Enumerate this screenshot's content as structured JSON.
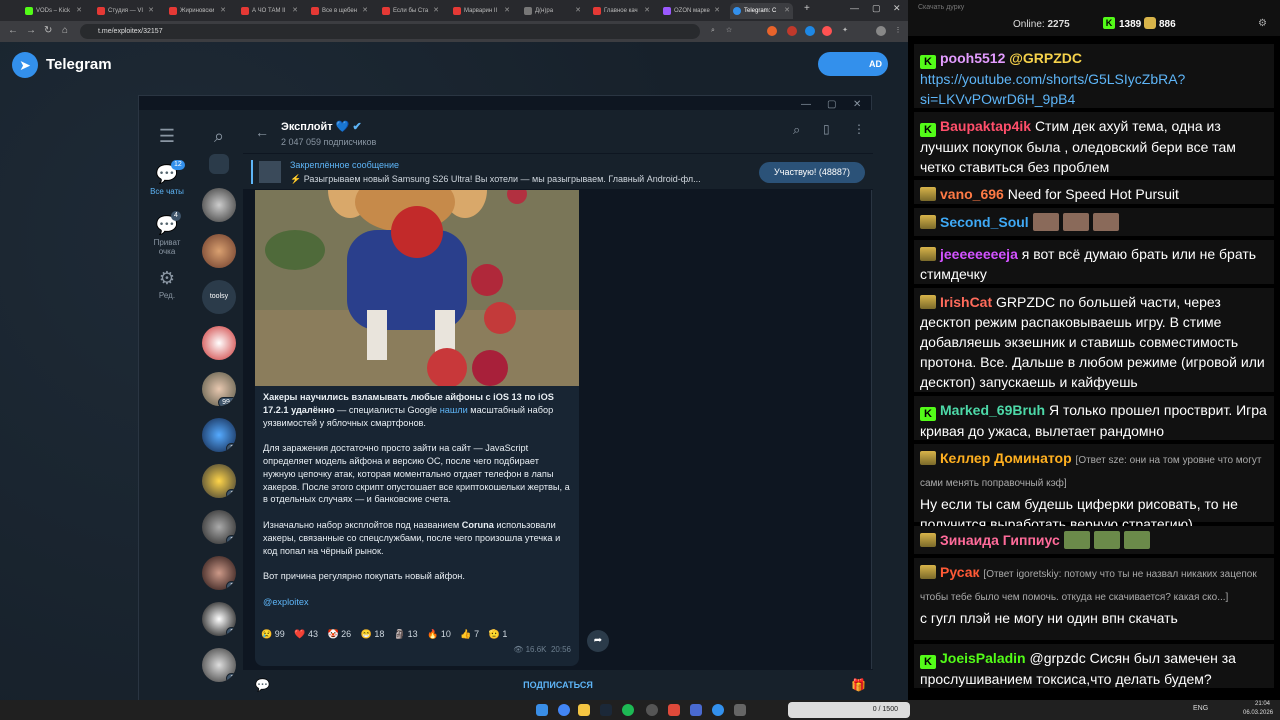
{
  "browser": {
    "tabs": [
      "VODs – Kick",
      "Студия — VI",
      "Жириновски",
      "А ЧО ТАМ II",
      "Все в щебен",
      "Если бы Ста",
      "Марварин II",
      "Д(н)ра",
      "Главное кач",
      "OZON марке",
      "Telegram: C"
    ],
    "url": "t.me/exploitex/32157"
  },
  "tgpage": {
    "title": "Telegram",
    "download": "AD"
  },
  "tgapp": {
    "nav": [
      {
        "label": "Все чаты",
        "badge": "12"
      },
      {
        "label": "Приват очка",
        "badge": "4"
      },
      {
        "label": "Ред."
      }
    ],
    "chat_badges": [
      "99+",
      "2",
      "1",
      "2",
      "2",
      "2",
      "1"
    ],
    "channel_name": "Эксплойт",
    "subscribers": "2 047 059 подписчиков",
    "pinned_title": "Закреплённое сообщение",
    "pinned_text": "⚡ Разыгрываем новый Samsung S26 Ultra! Вы хотели — мы разыгрываем. Главный Android-фл...",
    "join_button": "Участвую! (48887)",
    "msg_title": "Хакеры научились взламывать любые айфоны с iOS 13 по iOS 17.2.1 удалённо",
    "msg_p1_a": " — специалисты Google ",
    "msg_p1_link": "нашли",
    "msg_p1_b": " масштабный набор уязвимостей у яблочных смартфонов.",
    "msg_p2": "Для заражения достаточно просто зайти на сайт — JavaScript определяет модель айфона и версию ОС, после чего подбирает нужную цепочку атак, которая моментально отдает телефон в лапы хакеров. После этого скрипт опустошает все криптокошельки жертвы, а в отдельных случаях — и банковские счета.",
    "msg_p3_a": "Изначально набор эксплойтов под названием ",
    "msg_p3_bold": "Coruna",
    "msg_p3_b": " использовали хакеры, связанные со спецслужбами, после чего произошла утечка и код попал на чёрный рынок.",
    "msg_p4": "Вот причина регулярно покупать новый айфон.",
    "msg_tag": "@exploitex",
    "reactions": [
      "😢 99",
      "❤️ 43",
      "🤡 26",
      "😁 18",
      "🗿 13",
      "🔥 10",
      "👍 7",
      "🫡 1"
    ],
    "views": "👁 16.6K",
    "time": "20:56",
    "subscribe": "ПОДПИСАТЬСЯ"
  },
  "stream": {
    "header_left": "Скачать дурку",
    "online_label": "Online:",
    "online": "2275",
    "count1": "1389",
    "count2": "886",
    "messages": [
      {
        "user": "pooh5512",
        "color": "#e39cff",
        "text": "@GRPZDC",
        "link": "https://youtube.com/shorts/G5LSIycZbRA?si=LKVvPOwrD6H_9pB4"
      },
      {
        "user": "Baupaktap4ik",
        "color": "#ff4f6b",
        "text": "Стим дек ахуй тема, одна из лучших покупок была , оледовский бери все там четко ставиться без проблем"
      },
      {
        "user": "vano_696",
        "color": "#ff7a45",
        "text": "Need for Speed Hot Pursuit"
      },
      {
        "user": "Second_Soul",
        "color": "#3fa9f5",
        "text": ""
      },
      {
        "user": "jeeeeeeeeja",
        "color": "#d252ff",
        "text": "я вот всё думаю брать или не брать стимдечку"
      },
      {
        "user": "IrishCat",
        "color": "#ff6b5b",
        "text": "GRPZDC по большей части, через десктоп режим распаковываешь игру. В стиме добавляешь экзешник и ставишь совместимость протона. Все. Дальше в любом режиме (игровой или десктоп) запускаешь и кайфуешь"
      },
      {
        "user": "Marked_69Bruh",
        "color": "#4dd9a8",
        "text": "Я только прошел простврит. Игра кривая до ужаса, вылетает рандомно"
      },
      {
        "user": "Келлер Доминатор",
        "color": "#ffb020",
        "reply": "[Ответ sze: они на том уровне что могут сами менять поправочный кэф]",
        "text": "Ну если ты сам будешь циферки рисовать, то не получится выработать верную стратегию)"
      },
      {
        "user": "Зинаида Гиппиус",
        "color": "#ff6b9a",
        "text": ""
      },
      {
        "user": "Русак",
        "color": "#ff5a36",
        "reply": "[Ответ igoretskiy: потому что ты не назвал никаких зацепок чтобы тебе было чем помочь. откуда не скачивается? какая ско...]",
        "text": "с гугл плэй не могу ни один впн скачать"
      },
      {
        "user": "JoeisPaladin",
        "color": "#53fc18",
        "text": "@grpzdc Сисян был замечен за прослушиванием токсиса,что делать будем?"
      }
    ]
  },
  "taskbar": {
    "lang": "ENG",
    "time": "21:04",
    "date": "06.03.2026",
    "overlay": "0 / 1500"
  }
}
